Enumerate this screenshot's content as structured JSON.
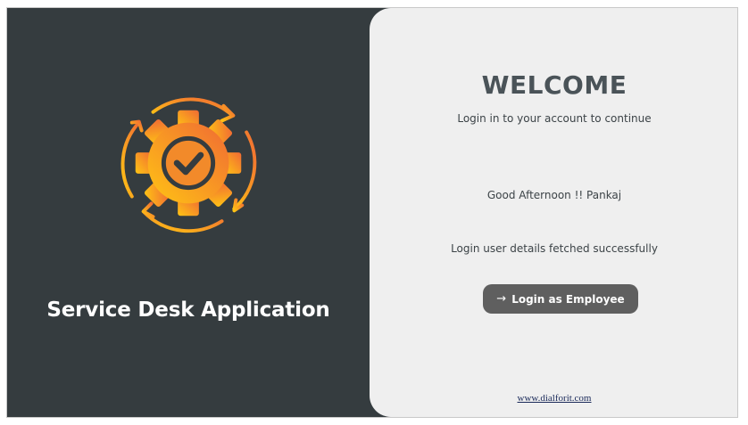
{
  "left": {
    "app_title": "Service Desk Application",
    "logo_icon": "gear-check-cycle-icon",
    "colors": {
      "background": "#353c3f",
      "gradient_start": "#ffb414",
      "gradient_end": "#f06e32"
    }
  },
  "right": {
    "welcome_title": "WELCOME",
    "subtitle": "Login in to your account to continue",
    "greeting": "Good Afternoon !! Pankaj",
    "status_message": "Login user details fetched successfully",
    "login_button": {
      "icon": "arrow-right-icon",
      "label": "Login as Employee"
    },
    "footer_link": "www.dialforit.com"
  }
}
